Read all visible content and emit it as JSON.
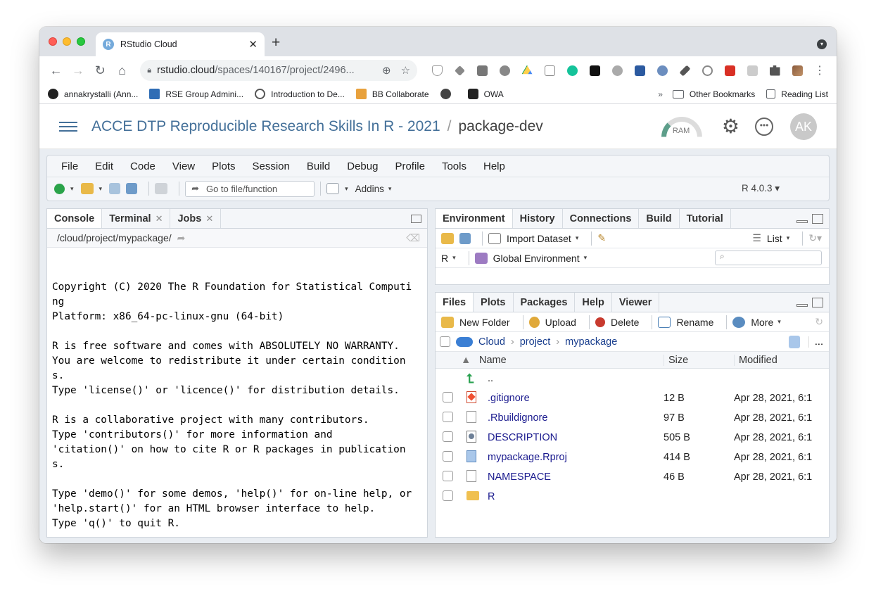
{
  "browser": {
    "tab_title": "RStudio Cloud",
    "tab_favicon": "R",
    "url_host": "rstudio.cloud",
    "url_path": "/spaces/140167/project/2496...",
    "bookmarks": [
      "annakrystalli (Ann...",
      "RSE Group Admini...",
      "Introduction to De...",
      "BB Collaborate",
      "",
      "OWA"
    ],
    "bookmark_overflow": "»",
    "other_bookmarks": "Other Bookmarks",
    "reading_list": "Reading List"
  },
  "cloud_header": {
    "space_title": "ACCE DTP Reproducible Research Skills In R - 2021",
    "separator": "/",
    "project_title": "package-dev",
    "ram_label": "RAM",
    "avatar_initials": "AK"
  },
  "menubar": [
    "File",
    "Edit",
    "Code",
    "View",
    "Plots",
    "Session",
    "Build",
    "Debug",
    "Profile",
    "Tools",
    "Help"
  ],
  "ide_toolbar": {
    "goto_placeholder": "Go to file/function",
    "addins_label": "Addins",
    "r_version": "R 4.0.3"
  },
  "console_pane": {
    "tabs": [
      {
        "label": "Console",
        "closable": false
      },
      {
        "label": "Terminal",
        "closable": true
      },
      {
        "label": "Jobs",
        "closable": true
      }
    ],
    "path": "/cloud/project/mypackage/",
    "lines": [
      "Copyright (C) 2020 The R Foundation for Statistical Computi",
      "ng",
      "Platform: x86_64-pc-linux-gnu (64-bit)",
      "",
      "R is free software and comes with ABSOLUTELY NO WARRANTY.",
      "You are welcome to redistribute it under certain condition",
      "s.",
      "Type 'license()' or 'licence()' for distribution details.",
      "",
      "R is a collaborative project with many contributors.",
      "Type 'contributors()' for more information and",
      "'citation()' on how to cite R or R packages in publication",
      "s.",
      "",
      "Type 'demo()' for some demos, 'help()' for on-line help, or",
      "'help.start()' for an HTML browser interface to help.",
      "Type 'q()' to quit R."
    ],
    "prompt": ">"
  },
  "env_pane": {
    "tabs": [
      "Environment",
      "History",
      "Connections",
      "Build",
      "Tutorial"
    ],
    "import_dataset": "Import Dataset",
    "list_view": "List",
    "language": "R",
    "global_env": "Global Environment"
  },
  "files_pane": {
    "tabs": [
      "Files",
      "Plots",
      "Packages",
      "Help",
      "Viewer"
    ],
    "toolbar": {
      "new_folder": "New Folder",
      "upload": "Upload",
      "delete": "Delete",
      "rename": "Rename",
      "more": "More"
    },
    "breadcrumb": [
      "Cloud",
      "project",
      "mypackage"
    ],
    "more_dots": "...",
    "columns": {
      "name": "Name",
      "size": "Size",
      "modified": "Modified"
    },
    "parent_dir": "..",
    "files": [
      {
        "name": ".gitignore",
        "size": "12 B",
        "modified": "Apr 28, 2021, 6:1",
        "icon": "git-icon"
      },
      {
        "name": ".Rbuildignore",
        "size": "97 B",
        "modified": "Apr 28, 2021, 6:1",
        "icon": "file-icon"
      },
      {
        "name": "DESCRIPTION",
        "size": "505 B",
        "modified": "Apr 28, 2021, 6:1",
        "icon": "description-icon"
      },
      {
        "name": "mypackage.Rproj",
        "size": "414 B",
        "modified": "Apr 28, 2021, 6:1",
        "icon": "rproj-icon"
      },
      {
        "name": "NAMESPACE",
        "size": "46 B",
        "modified": "Apr 28, 2021, 6:1",
        "icon": "file-icon"
      },
      {
        "name": "R",
        "size": "",
        "modified": "",
        "icon": "folder-icon"
      }
    ]
  }
}
